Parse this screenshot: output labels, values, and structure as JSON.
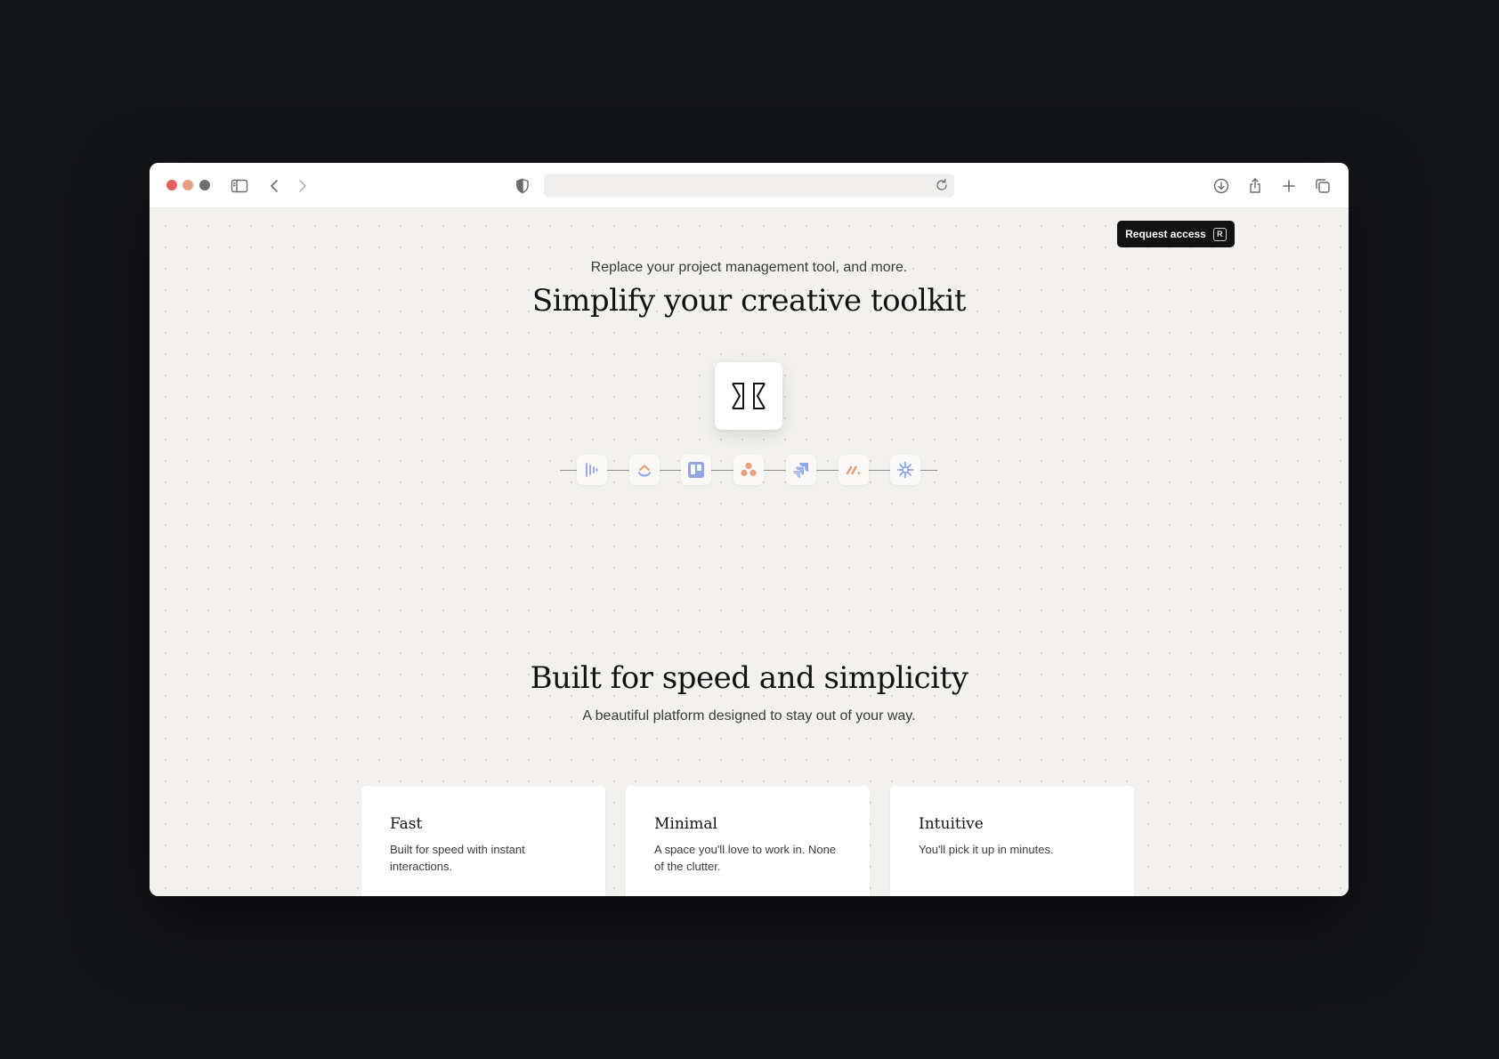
{
  "browser": {
    "url": "",
    "icons": [
      "sidebar-icon",
      "back-icon",
      "forward-icon",
      "shield-icon",
      "reload-icon",
      "download-icon",
      "share-icon",
      "new-tab-icon",
      "tabs-overview-icon"
    ]
  },
  "header": {
    "request_access_label": "Request access",
    "request_access_shortcut": "R"
  },
  "hero": {
    "tagline": "Replace your project management tool, and more.",
    "title": "Simplify your creative toolkit",
    "logo": "hourglass-logo-icon"
  },
  "integrations": [
    {
      "icon": "linear-icon",
      "color": "#8ea6e6"
    },
    {
      "icon": "clickup-icon",
      "color": "#e8a07e"
    },
    {
      "icon": "trello-icon",
      "color": "#8ea6e6"
    },
    {
      "icon": "asana-icon",
      "color": "#e8a07e"
    },
    {
      "icon": "jira-icon",
      "color": "#8ea6e6"
    },
    {
      "icon": "monday-icon",
      "color": "#e8a07e"
    },
    {
      "icon": "spark-icon",
      "color": "#8ea6e6"
    }
  ],
  "features": {
    "title": "Built for speed and simplicity",
    "subtitle": "A beautiful platform designed to stay out of your way.",
    "cards": [
      {
        "title": "Fast",
        "description": "Built for speed with instant interactions."
      },
      {
        "title": "Minimal",
        "description": "A space you'll love to work in. None of the clutter."
      },
      {
        "title": "Intuitive",
        "description": "You'll pick it up in minutes."
      }
    ]
  },
  "colors": {
    "accent_blue": "#8ea6e6",
    "accent_peach": "#e8a07e",
    "background": "#f2f1ee",
    "button_dark": "#121212"
  }
}
